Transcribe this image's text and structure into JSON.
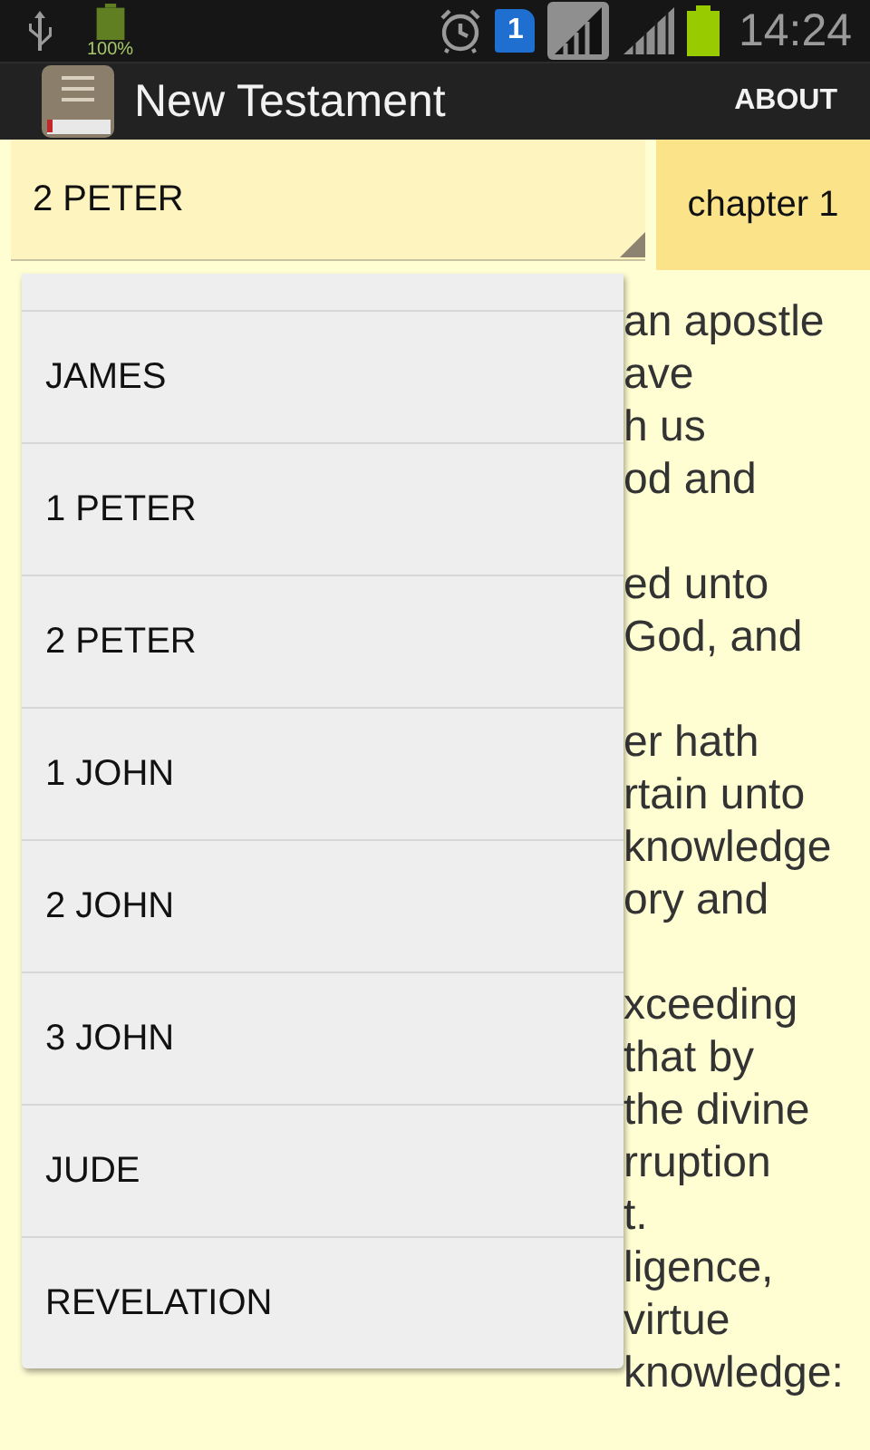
{
  "status_bar": {
    "battery_label": "100%",
    "sim_badge": "1",
    "time": "14:24"
  },
  "action_bar": {
    "title": "New Testament",
    "action": "ABOUT"
  },
  "book_spinner": {
    "value": "2 PETER"
  },
  "chapter_button": {
    "label": "chapter 1"
  },
  "verse_text": [
    [
      "an apostle",
      "ave",
      "h us",
      "od and"
    ],
    [
      "ed unto",
      "God, and"
    ],
    [
      "er hath",
      "rtain unto",
      "knowledge",
      "ory and"
    ],
    [
      "xceeding",
      "that by",
      "the divine",
      "rruption",
      "t.",
      "ligence,",
      "virtue",
      "knowledge:"
    ]
  ],
  "dropdown": {
    "items": [
      "JAMES",
      "1 PETER",
      "2 PETER",
      "1 JOHN",
      "2 JOHN",
      "3 JOHN",
      "JUDE",
      "REVELATION"
    ]
  }
}
